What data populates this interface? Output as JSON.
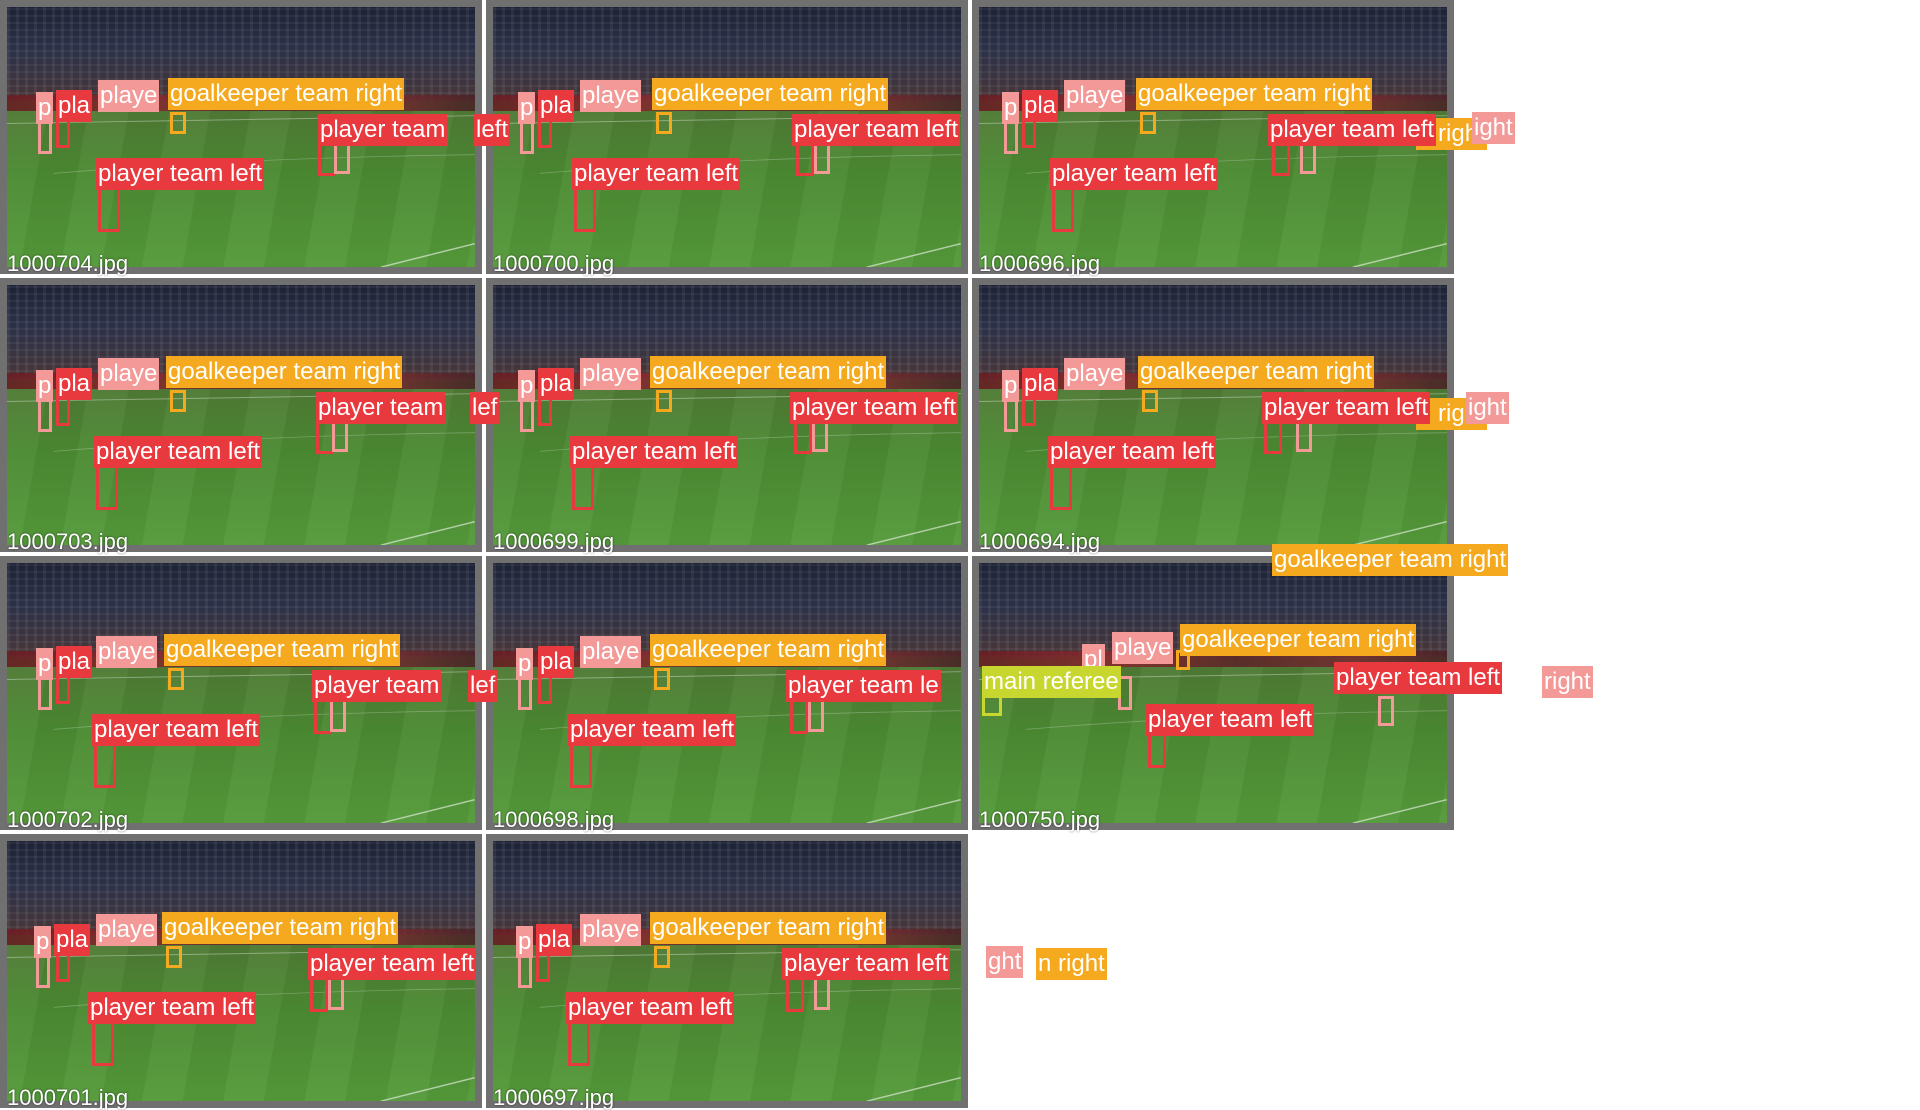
{
  "colors": {
    "player_team_left": "#e83a3e",
    "player_team_right": "#f39a98",
    "goalkeeper_team_right": "#f4a91e",
    "main_referee": "#c8d630",
    "tile_border": "#707070",
    "background": "#ffffff"
  },
  "tiles": [
    {
      "file": "1000704.jpg",
      "labels": [
        "p",
        "pla",
        "playe",
        "goalkeeper team right",
        "player team",
        "left",
        "player team left"
      ]
    },
    {
      "file": "1000700.jpg",
      "labels": [
        "p",
        "pla",
        "playe",
        "goalkeeper team right",
        "player team left",
        "player team left"
      ]
    },
    {
      "file": "1000696.jpg",
      "labels": [
        "p",
        "pla",
        "playe",
        "goalkeeper team right",
        "player team left",
        "ight",
        "n right",
        "player team left"
      ]
    },
    {
      "file": "1000703.jpg",
      "labels": [
        "p",
        "pla",
        "playe",
        "goalkeeper team right",
        "player team",
        "lef",
        "player team left"
      ]
    },
    {
      "file": "1000699.jpg",
      "labels": [
        "p",
        "pla",
        "playe",
        "goalkeeper team right",
        "player team left",
        "player team left"
      ]
    },
    {
      "file": "1000694.jpg",
      "labels": [
        "p",
        "pla",
        "playe",
        "goalkeeper team right",
        "player team left",
        "ight",
        "n right",
        "player team left"
      ]
    },
    {
      "file": "1000702.jpg",
      "labels": [
        "p",
        "pla",
        "playe",
        "goalkeeper team right",
        "player team",
        "lef",
        "player team left"
      ]
    },
    {
      "file": "1000698.jpg",
      "labels": [
        "p",
        "pla",
        "playe",
        "goalkeeper team right",
        "player team le",
        "player team left"
      ]
    },
    {
      "file": "1000750.jpg",
      "labels": [
        "goalkeeper team right",
        "pl",
        "playe",
        "goalkeeper team right",
        "main referee",
        "player team left",
        "right",
        "player team left"
      ]
    },
    {
      "file": "1000701.jpg",
      "labels": [
        "p",
        "pla",
        "playe",
        "goalkeeper team right",
        "player team left",
        "player team left"
      ]
    },
    {
      "file": "1000697.jpg",
      "labels": [
        "p",
        "pla",
        "playe",
        "goalkeeper team right",
        "player team left",
        "ght",
        "n right",
        "player team left"
      ]
    }
  ]
}
